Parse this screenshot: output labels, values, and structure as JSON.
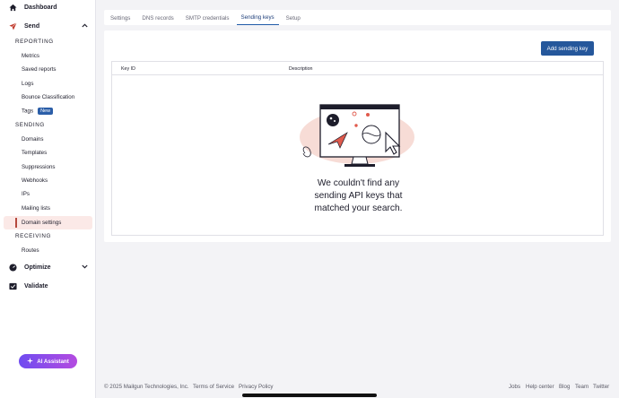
{
  "sidebar": {
    "dashboard": "Dashboard",
    "send": "Send",
    "reporting_header": "REPORTING",
    "reporting_items": [
      "Metrics",
      "Saved reports",
      "Logs",
      "Bounce Classification",
      "Tags"
    ],
    "tags_badge": "New",
    "sending_header": "SENDING",
    "sending_items": [
      "Domains",
      "Templates",
      "Suppressions",
      "Webhooks",
      "IPs",
      "Mailing lists",
      "Domain settings"
    ],
    "receiving_header": "RECEIVING",
    "receiving_items": [
      "Routes"
    ],
    "optimize": "Optimize",
    "validate": "Validate",
    "ai_assistant": "AI Assistant"
  },
  "tabs": [
    "Settings",
    "DNS records",
    "SMTP credentials",
    "Sending keys",
    "Setup"
  ],
  "active_tab": "Sending keys",
  "card": {
    "add_button": "Add sending key",
    "columns": [
      "Key ID",
      "Description"
    ],
    "empty_lines": [
      "We couldn't find any",
      "sending API keys that",
      "matched your search."
    ]
  },
  "footer": {
    "copyright": "© 2025 Mailgun Technologies, Inc.",
    "links_left": [
      "Terms of Service",
      "Privacy Policy"
    ],
    "links_right": [
      "Jobs",
      "Help center",
      "Blog",
      "Team",
      "Twitter"
    ]
  },
  "colors": {
    "accent": "#25579b",
    "active_bg": "#fbe9e7",
    "active_bar": "#b5493d",
    "ai_gradient_start": "#6f4cf0",
    "ai_gradient_end": "#b44be0"
  }
}
